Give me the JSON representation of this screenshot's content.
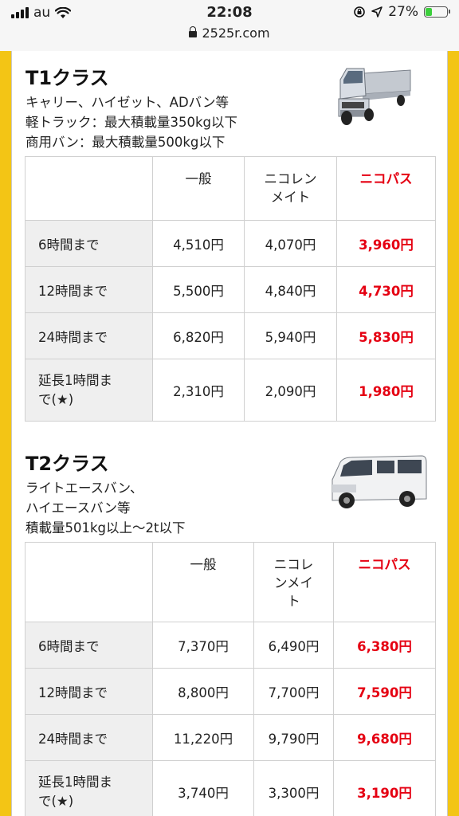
{
  "status_bar": {
    "carrier": "au",
    "time": "22:08",
    "battery_percent": "27%",
    "battery_level": 0.27,
    "url": "2525r.com"
  },
  "colors": {
    "frame_yellow": "#f3c515",
    "price_red": "#e50012",
    "row_gray": "#efefef"
  },
  "columns": [
    "一般",
    "ニコレン\nメイト",
    "ニコパス"
  ],
  "t1": {
    "title": "T1クラス",
    "desc": [
      "キャリー、ハイゼット、ADバン等",
      "軽トラック：最大積載量350kg以下",
      "商用バン：最大積載量500kg以下"
    ],
    "vehicle_icon": "kei-truck-image",
    "header": [
      "一般",
      "ニコレン\nメイト",
      "ニコパス"
    ],
    "rows": [
      {
        "label": "6時間まで",
        "general": "4,510円",
        "mate": "4,070円",
        "pass": "3,960円"
      },
      {
        "label": "12時間まで",
        "general": "5,500円",
        "mate": "4,840円",
        "pass": "4,730円"
      },
      {
        "label": "24時間まで",
        "general": "6,820円",
        "mate": "5,940円",
        "pass": "5,830円"
      },
      {
        "label": "延長1時間ま\nで(★)",
        "general": "2,310円",
        "mate": "2,090円",
        "pass": "1,980円"
      }
    ]
  },
  "t2": {
    "title": "T2クラス",
    "desc": [
      "ライトエースバン、",
      "ハイエースバン等",
      "積載量501kg以上～2t以下"
    ],
    "vehicle_icon": "van-image",
    "header": [
      "一般",
      "ニコレ\nンメイ\nト",
      "ニコパス"
    ],
    "rows": [
      {
        "label": "6時間まで",
        "general": "7,370円",
        "mate": "6,490円",
        "pass": "6,380円"
      },
      {
        "label": "12時間まで",
        "general": "8,800円",
        "mate": "7,700円",
        "pass": "7,590円"
      },
      {
        "label": "24時間まで",
        "general": "11,220円",
        "mate": "9,790円",
        "pass": "9,680円"
      },
      {
        "label": "延長1時間ま\nで(★)",
        "general": "3,740円",
        "mate": "3,300円",
        "pass": "3,190円"
      }
    ]
  }
}
